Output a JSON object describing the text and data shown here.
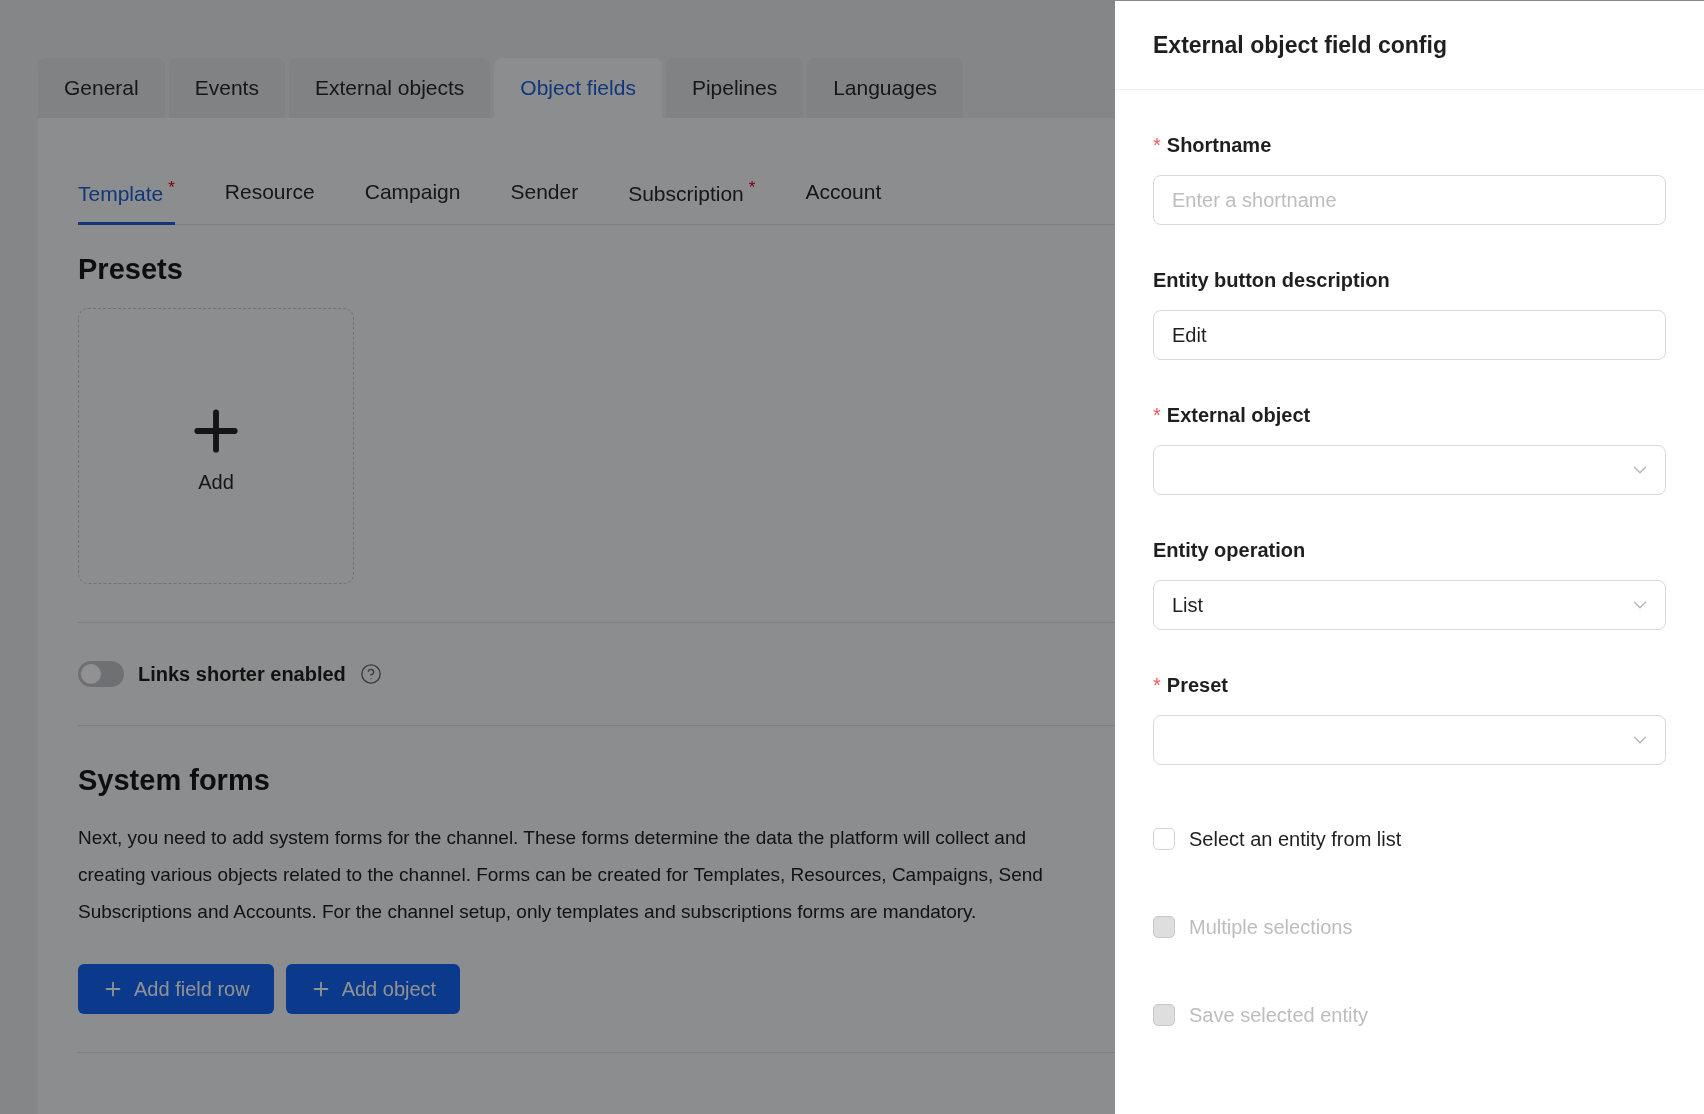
{
  "tabs": [
    {
      "label": "General",
      "selected": false
    },
    {
      "label": "Events",
      "selected": false
    },
    {
      "label": "External objects",
      "selected": false
    },
    {
      "label": "Object fields",
      "selected": true
    },
    {
      "label": "Pipelines",
      "selected": false
    },
    {
      "label": "Languages",
      "selected": false
    }
  ],
  "subtabs": [
    {
      "label": "Template",
      "required_mark": "*",
      "selected": true
    },
    {
      "label": "Resource",
      "selected": false
    },
    {
      "label": "Campaign",
      "selected": false
    },
    {
      "label": "Sender",
      "selected": false
    },
    {
      "label": "Subscription",
      "required_mark": "*",
      "selected": false
    },
    {
      "label": "Account",
      "selected": false
    }
  ],
  "presets": {
    "title": "Presets",
    "add_label": "Add"
  },
  "links_toggle": {
    "label": "Links shorter enabled",
    "on": false
  },
  "system_forms": {
    "title": "System forms",
    "text_lines": [
      "Next, you need to add system forms for the channel. These forms determine the data the platform will collect and",
      "creating various objects related to the channel. Forms can be created for Templates, Resources, Campaigns, Send",
      "Subscriptions and Accounts. For the channel setup, only templates and subscriptions forms are mandatory."
    ],
    "buttons": [
      "Add field row",
      "Add object"
    ]
  },
  "drawer": {
    "title": "External object field config",
    "fields": [
      {
        "kind": "input",
        "label": "Shortname",
        "required_mark": "*",
        "placeholder": "Enter a shortname"
      },
      {
        "kind": "input",
        "label": "Entity button description",
        "value": "Edit"
      },
      {
        "kind": "select",
        "label": "External object",
        "required_mark": "*"
      },
      {
        "kind": "select",
        "label": "Entity operation",
        "value": "List"
      },
      {
        "kind": "select",
        "label": "Preset",
        "required_mark": "*"
      }
    ],
    "checkboxes": [
      {
        "label": "Select an entity from list",
        "checked": false,
        "disabled": false
      },
      {
        "label": "Multiple selections",
        "checked": false,
        "disabled": true
      },
      {
        "label": "Save selected entity",
        "checked": false,
        "disabled": true
      }
    ]
  }
}
